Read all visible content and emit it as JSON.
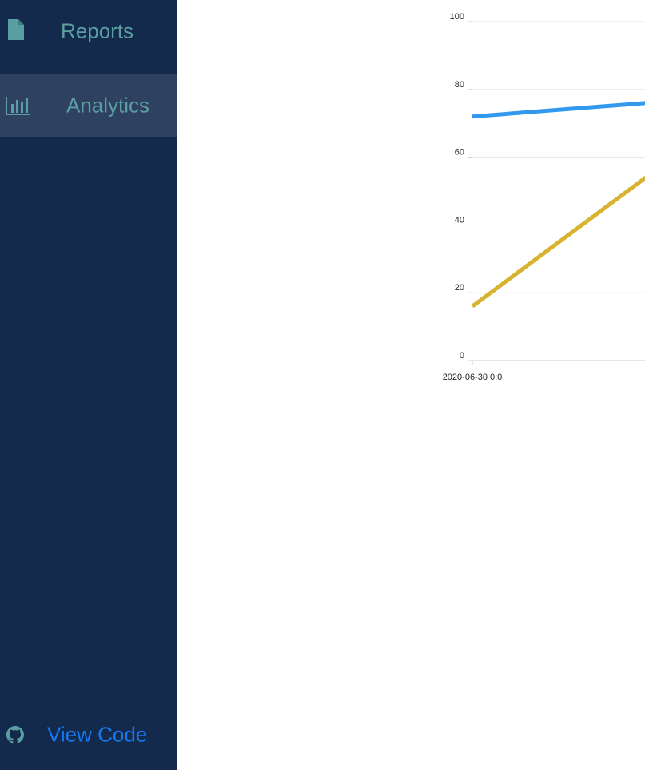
{
  "sidebar": {
    "items": [
      {
        "label": "Reports",
        "icon": "file-icon",
        "active": false
      },
      {
        "label": "Analytics",
        "icon": "bar-chart-icon",
        "active": true
      }
    ],
    "footer_link": {
      "label": "View Code",
      "icon": "github-icon"
    }
  },
  "colors": {
    "sidebar_bg": "#142a4c",
    "active_item_bg": "#2e4160",
    "nav_text": "#5b9ea1",
    "link_text": "#1677ee",
    "series_blue": "#3399ee",
    "series_gold": "#d8b330"
  },
  "chart_data": {
    "type": "line",
    "x": [
      "2020-06-30 0:0"
    ],
    "x_tick_labels": [
      "2020-06-30 0:0"
    ],
    "ylim": [
      0,
      100
    ],
    "y_ticks": [
      "0",
      "20",
      "40",
      "60",
      "80",
      "100"
    ],
    "grid": true,
    "series": [
      {
        "color": "#3399ee",
        "points": [
          {
            "x": "2020-06-30 0:0",
            "y": 72
          },
          {
            "x_fraction_right_edge": true,
            "y": 76
          }
        ]
      },
      {
        "color": "#d8b330",
        "points": [
          {
            "x": "2020-06-30 0:0",
            "y": 16
          },
          {
            "x_fraction_right_edge": true,
            "y": 54
          }
        ]
      }
    ]
  }
}
